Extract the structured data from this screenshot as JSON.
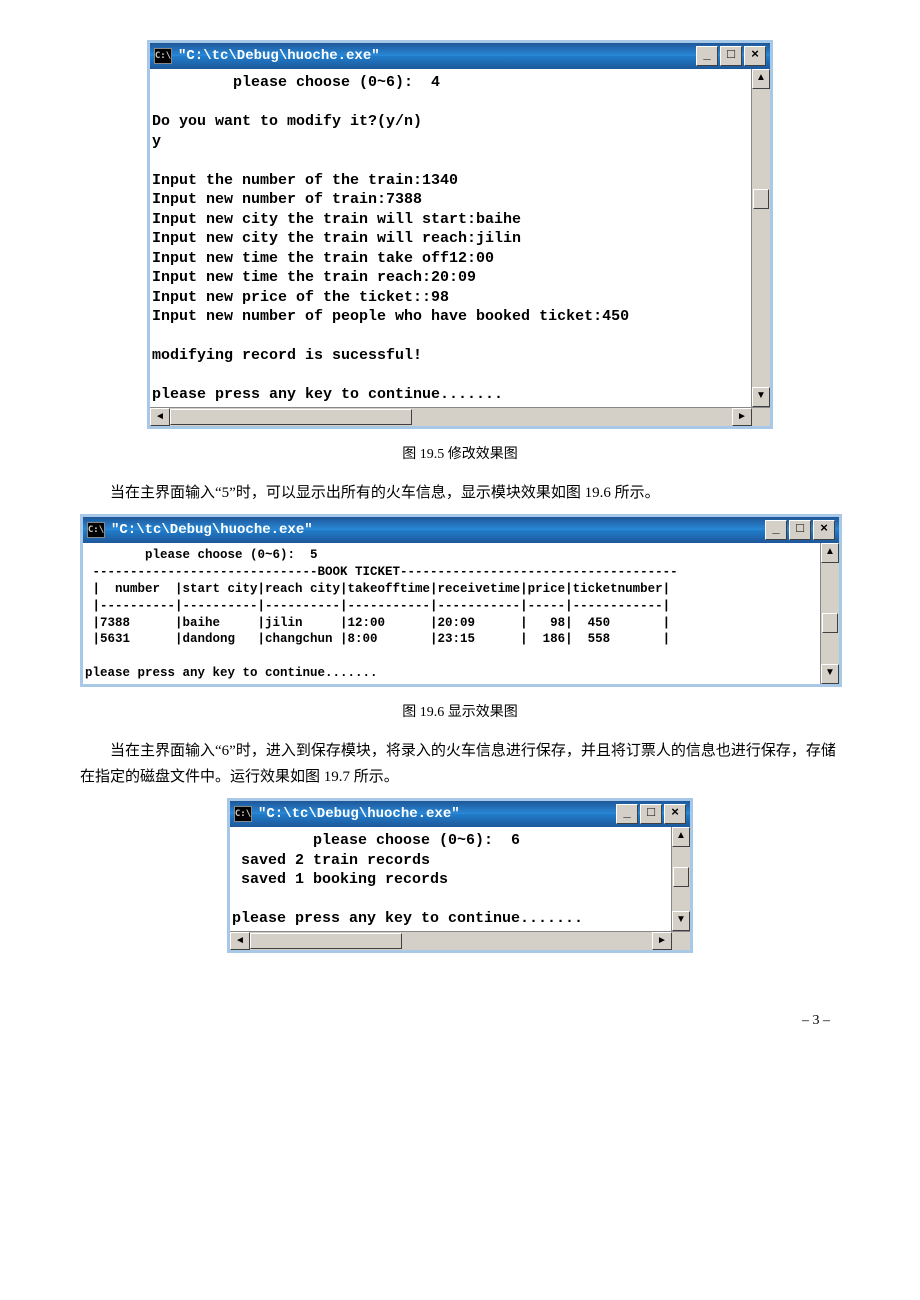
{
  "win1": {
    "title": "\"C:\\tc\\Debug\\huoche.exe\"",
    "icon": "C:\\",
    "content": "         please choose (0~6):  4\n\nDo you want to modify it?(y/n)\ny\n\nInput the number of the train:1340\nInput new number of train:7388\nInput new city the train will start:baihe\nInput new city the train will reach:jilin\nInput new time the train take off12:00\nInput new time the train reach:20:09\nInput new price of the ticket::98\nInput new number of people who have booked ticket:450\n\nmodifying record is sucessful!\n\nplease press any key to continue......."
  },
  "fig1_caption": "图 19.5    修改效果图",
  "para1": "当在主界面输入“5”时，可以显示出所有的火车信息，显示模块效果如图 19.6 所示。",
  "win2": {
    "title": "\"C:\\tc\\Debug\\huoche.exe\"",
    "icon": "C:\\",
    "content": "        please choose (0~6):  5\n ------------------------------BOOK TICKET-------------------------------------\n |  number  |start city|reach city|takeofftime|receivetime|price|ticketnumber|\n |----------|----------|----------|-----------|-----------|-----|------------|\n |7388      |baihe     |jilin     |12:00      |20:09      |   98|  450       |\n |5631      |dandong   |changchun |8:00       |23:15      |  186|  558       |\n\nplease press any key to continue......."
  },
  "fig2_caption": "图 19.6    显示效果图",
  "para2": "当在主界面输入“6”时，进入到保存模块，将录入的火车信息进行保存，并且将订票人的信息也进行保存，存储在指定的磁盘文件中。运行效果如图 19.7 所示。",
  "win3": {
    "title": "\"C:\\tc\\Debug\\huoche.exe\"",
    "icon": "C:\\",
    "content": "         please choose (0~6):  6\n saved 2 train records\n saved 1 booking records\n\nplease press any key to continue......."
  },
  "page_number": "– 3 –",
  "buttons": {
    "minimize": "_",
    "maximize": "□",
    "close": "×",
    "up": "▲",
    "down": "▼",
    "left": "◄",
    "right": "►"
  }
}
